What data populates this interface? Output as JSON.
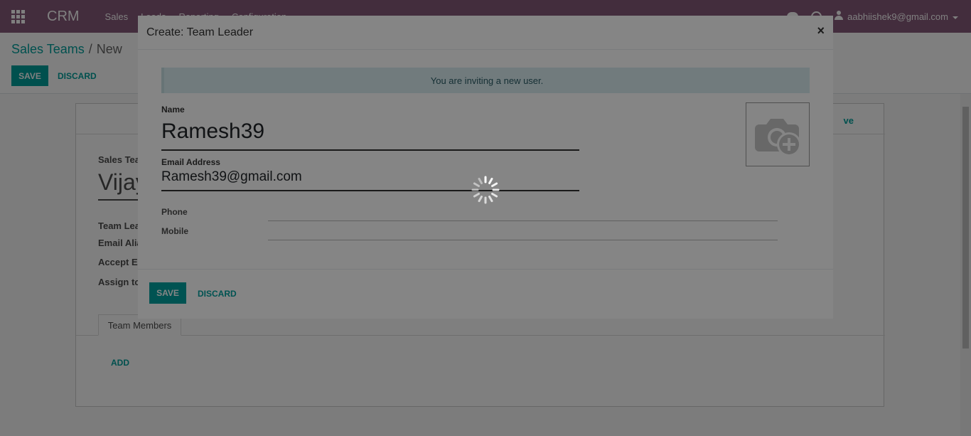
{
  "navbar": {
    "brand": "CRM",
    "menu": [
      "Sales",
      "Leads",
      "Reporting",
      "Configuration"
    ],
    "user": "aabhiishek9@gmail.com"
  },
  "control_panel": {
    "breadcrumb_parent": "Sales Teams",
    "breadcrumb_current": "New",
    "save_label": "SAVE",
    "discard_label": "DISCARD"
  },
  "sheet": {
    "archive_label": "ve",
    "sales_team_label": "Sales Tea",
    "team_name": "Vijay",
    "team_leader_label": "Team Lea",
    "email_alias_label": "Email Alia",
    "accept_emails_label": "Accept Er",
    "assign_label": "Assign to",
    "tab_team_members": "Team Members",
    "add_label": "ADD"
  },
  "modal": {
    "title": "Create: Team Leader",
    "close_glyph": "×",
    "alert": "You are inviting a new user.",
    "name_label": "Name",
    "name_value": "Ramesh39",
    "email_label": "Email Address",
    "email_value": "Ramesh39@gmail.com",
    "phone_label": "Phone",
    "mobile_label": "Mobile",
    "save_label": "SAVE",
    "discard_label": "DISCARD"
  },
  "icons": {
    "apps": "apps-grid-icon",
    "chat": "chat-icon",
    "help": "help-icon",
    "user": "user-icon",
    "avatar": "camera-plus-icon",
    "loading": "spinner-icon"
  },
  "colors": {
    "navbar": "#875a7b",
    "primary": "#00a09d",
    "alert_bg": "#d9ecef"
  }
}
